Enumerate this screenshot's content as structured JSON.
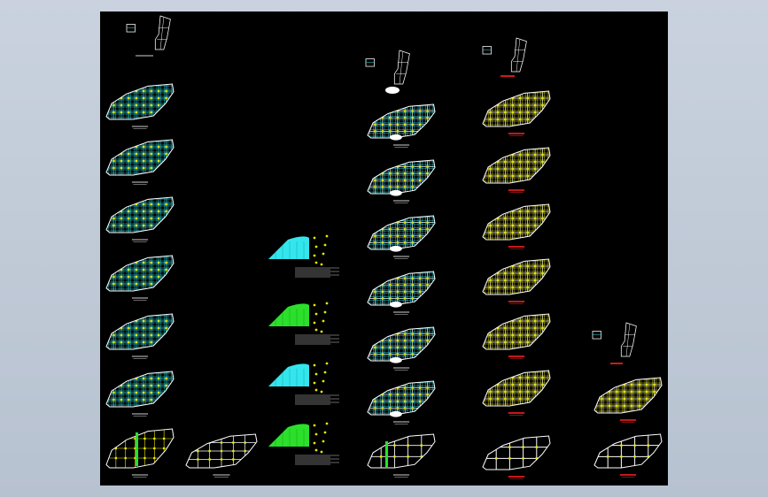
{
  "drawing": {
    "background": "#000000",
    "colors": {
      "cyan": "#33e6ee",
      "white": "#ffffff",
      "yellow": "#e6e600",
      "green": "#2be02b",
      "red": "#ff2222",
      "grey": "#cfcfcf"
    },
    "sheet_groups": [
      {
        "name": "col-a",
        "count": 7,
        "style": "cyan-dense"
      },
      {
        "name": "col-b",
        "count": 1,
        "style": "white-grid"
      },
      {
        "name": "col-c",
        "count": 4,
        "style": "fan-with-schedule"
      },
      {
        "name": "col-d",
        "count": 7,
        "style": "white-cyan"
      },
      {
        "name": "col-e",
        "count": 8,
        "style": "white-yellow"
      },
      {
        "name": "col-f",
        "count": 3,
        "style": "white-yellow"
      }
    ]
  }
}
